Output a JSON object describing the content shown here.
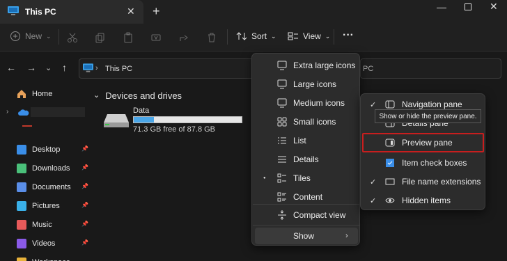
{
  "window": {
    "tab_title": "This PC",
    "new_tab_glyph": "+",
    "close_glyph": "✕",
    "minimize_glyph": "—",
    "win_close_glyph": "✕"
  },
  "toolbar": {
    "new_label": "New",
    "sort_label": "Sort",
    "view_label": "View",
    "more_glyph": "···"
  },
  "address": {
    "path": "This PC",
    "search_placeholder": "PC"
  },
  "sidebar": {
    "home": "Home",
    "items": [
      {
        "label": "Desktop",
        "icon": "desktop-icon"
      },
      {
        "label": "Downloads",
        "icon": "download-icon"
      },
      {
        "label": "Documents",
        "icon": "document-icon"
      },
      {
        "label": "Pictures",
        "icon": "picture-icon"
      },
      {
        "label": "Music",
        "icon": "music-icon"
      },
      {
        "label": "Videos",
        "icon": "video-icon"
      },
      {
        "label": "Workspace",
        "icon": "folder-icon"
      }
    ]
  },
  "main": {
    "section_title": "Devices and drives",
    "drive": {
      "name": "Data",
      "free_text": "71.3 GB free of 87.8 GB",
      "used_fraction": 0.19
    }
  },
  "view_menu": {
    "items": [
      {
        "label": "Extra large icons",
        "icon": "monitor-icon"
      },
      {
        "label": "Large icons",
        "icon": "monitor-icon"
      },
      {
        "label": "Medium icons",
        "icon": "monitor-icon"
      },
      {
        "label": "Small icons",
        "icon": "grid-icon"
      },
      {
        "label": "List",
        "icon": "list-icon"
      },
      {
        "label": "Details",
        "icon": "details-icon"
      },
      {
        "label": "Tiles",
        "icon": "tiles-icon",
        "selected": true
      },
      {
        "label": "Content",
        "icon": "content-icon"
      }
    ],
    "compact_label": "Compact view",
    "show_label": "Show",
    "selected_glyph": "●",
    "arrow_glyph": "›"
  },
  "show_menu": {
    "items": [
      {
        "label": "Navigation pane",
        "checked": true
      },
      {
        "label": "Details pane",
        "checked": false
      },
      {
        "label": "Preview pane",
        "checked": false
      },
      {
        "label": "Item check boxes",
        "checked": false
      },
      {
        "label": "File name extensions",
        "checked": true
      },
      {
        "label": "Hidden items",
        "checked": true
      }
    ],
    "check_glyph": "✓",
    "tooltip": "Show or hide the preview pane."
  },
  "colors": {
    "accent": "#4aa6e8",
    "highlight": "#c81e1e",
    "menu_bg": "#2c2c2c"
  }
}
